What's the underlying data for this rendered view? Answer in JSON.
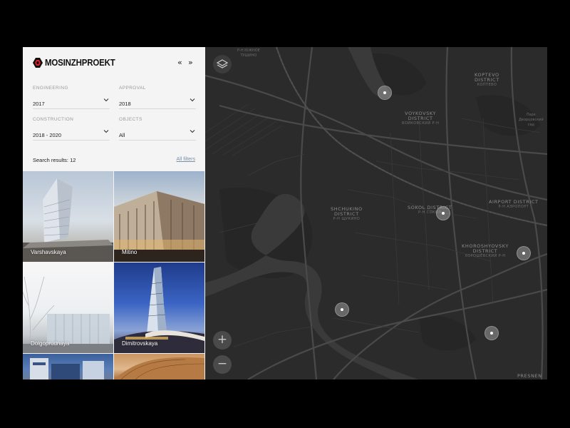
{
  "brand": {
    "name": "MOSINZHPROEKT",
    "logo_icon": "mosinzhproekt-logo-icon"
  },
  "header": {
    "prev_label": "«",
    "next_label": "»"
  },
  "filters": {
    "engineering": {
      "label": "ENGINEERING",
      "value": "2017"
    },
    "approval": {
      "label": "APPROVAL",
      "value": "2018"
    },
    "construction": {
      "label": "CONSTRUCTION",
      "value": "2018 - 2020"
    },
    "objects": {
      "label": "OBJECTS",
      "value": "All"
    }
  },
  "results": {
    "text": "Search results: 12",
    "all_filters": "All filters"
  },
  "projects": [
    {
      "name": "Varshavskaya"
    },
    {
      "name": "Mitino"
    },
    {
      "name": "Dolgoprudnaya"
    },
    {
      "name": "Dimitrovskaya"
    },
    {
      "name": ""
    },
    {
      "name": ""
    }
  ],
  "map": {
    "labels": {
      "koptevo": {
        "main": [
          "KOPTEVO",
          "DISTRICT"
        ],
        "ru": "КОПТЕВО"
      },
      "voykovsky": {
        "main": [
          "VOYKOVSKY",
          "DISTRICT"
        ],
        "ru": "ВОЙКОВСКИЙ Р-Н"
      },
      "shchukino": {
        "main": [
          "SHCHUKINO",
          "DISTRICT"
        ],
        "ru": "Р-Н ЩУКИНО"
      },
      "sokol": {
        "main": [
          "SOKOL DISTRICT"
        ],
        "ru": "Р-Н СОКОЛ"
      },
      "airport": {
        "main": [
          "AIRPORT DISTRICT"
        ],
        "ru": "Р-Н АЭРОПОРТ"
      },
      "khoroshyovsky": {
        "main": [
          "KHOROSHYOVSKY",
          "DISTRICT"
        ],
        "ru": "ХОРОШЁВСКИЙ Р-Н"
      },
      "presnensky": {
        "main": [
          "PRESNEN"
        ]
      },
      "yuzhnoe_tushino": {
        "small": [
          "Р-Н ЮЖНОЕ",
          "ТУШИНО"
        ]
      },
      "park": {
        "small": [
          "Парк",
          "Дворцовский",
          "сад"
        ]
      }
    },
    "zoom_in_label": "+",
    "zoom_out_label": "−"
  },
  "colors": {
    "panel_bg": "#f4f4f4",
    "map_bg": "#2b2b2b",
    "accent_red": "#e31e24",
    "link": "#7a8fa6"
  }
}
